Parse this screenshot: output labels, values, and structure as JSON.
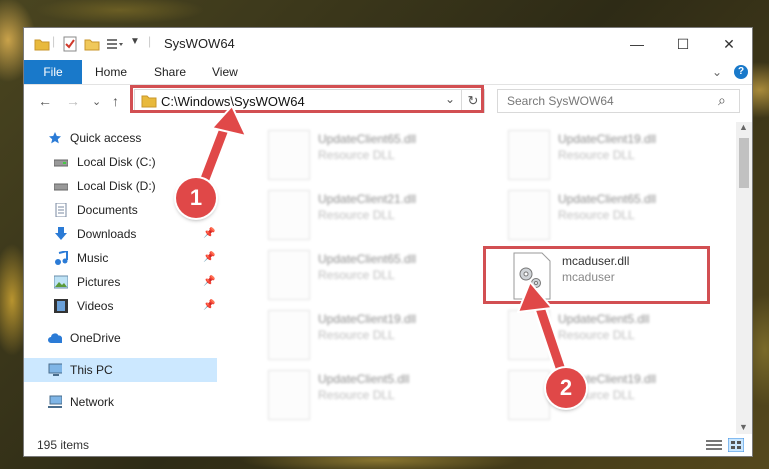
{
  "window": {
    "title": "SysWOW64",
    "minimize": "—",
    "maximize": "☐",
    "close": "✕"
  },
  "ribbon": {
    "file": "File",
    "tabs": [
      "Home",
      "Share",
      "View"
    ],
    "expand": "⌄",
    "help": "?"
  },
  "address": {
    "back": "←",
    "forward": "→",
    "recent": "⌄",
    "up": "↑",
    "path": "C:\\Windows\\SysWOW64",
    "dropdown": "⌄",
    "refresh": "↻"
  },
  "search": {
    "placeholder": "Search SysWOW64",
    "icon": "⌕"
  },
  "nav": {
    "quick_access": "Quick access",
    "items": [
      {
        "label": "Local Disk (C:)",
        "pinned": false
      },
      {
        "label": "Local Disk (D:)",
        "pinned": false
      },
      {
        "label": "Documents",
        "pinned": false
      },
      {
        "label": "Downloads",
        "pinned": true
      },
      {
        "label": "Music",
        "pinned": true
      },
      {
        "label": "Pictures",
        "pinned": true
      },
      {
        "label": "Videos",
        "pinned": true
      }
    ],
    "onedrive": "OneDrive",
    "this_pc": "This PC",
    "network": "Network",
    "pin_glyph": "📌"
  },
  "files": [
    {
      "name": "UpdateClient65.dll",
      "desc": "Resource DLL"
    },
    {
      "name": "UpdateClient19.dll",
      "desc": "Resource DLL"
    },
    {
      "name": "UpdateClient21.dll",
      "desc": "Resource DLL"
    },
    {
      "name": "UpdateClient65.dll",
      "desc": "Resource DLL"
    },
    {
      "name": "UpdateClient65.dll",
      "desc": "Resource DLL"
    },
    {
      "name": "mcaduser.dll",
      "desc": "mcaduser"
    },
    {
      "name": "UpdateClient19.dll",
      "desc": "Resource DLL"
    },
    {
      "name": "UpdateClient5.dll",
      "desc": "Resource DLL"
    },
    {
      "name": "UpdateClient5.dll",
      "desc": "Resource DLL"
    },
    {
      "name": "UpdateClient19.dll",
      "desc": "Resource DLL"
    }
  ],
  "status": {
    "count": "195 items"
  },
  "annotations": {
    "step1": "1",
    "step2": "2"
  },
  "colors": {
    "accent": "#1979ca",
    "highlight": "#d24f52",
    "selection": "#cce8ff"
  }
}
